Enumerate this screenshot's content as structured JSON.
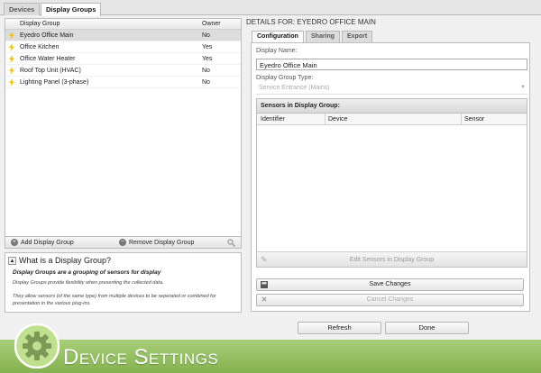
{
  "top_tabs": [
    {
      "label": "Devices",
      "active": false
    },
    {
      "label": "Display Groups",
      "active": true
    }
  ],
  "groups_table": {
    "columns": [
      "Display Group",
      "Owner"
    ],
    "rows": [
      {
        "name": "Eyedro Office Main",
        "owner": "No",
        "selected": true
      },
      {
        "name": "Office Kitchen",
        "owner": "Yes",
        "selected": false
      },
      {
        "name": "Office Water Heater",
        "owner": "Yes",
        "selected": false
      },
      {
        "name": "Roof Top Unit (HVAC)",
        "owner": "No",
        "selected": false
      },
      {
        "name": "Lighting Panel (3-phase)",
        "owner": "No",
        "selected": false
      }
    ]
  },
  "left_toolbar": {
    "add_label": "Add Display Group",
    "remove_label": "Remove Display Group"
  },
  "info": {
    "title": "What is a Display Group?",
    "line1": "Display Groups are a grouping of sensors for display",
    "line2": "Display Groups provide flexibility when presenting the collected data.",
    "line3": "They allow sensors (of the same type) from multiple devices to be seperated or combined for presentation in the various plug-ins."
  },
  "details": {
    "title": "DETAILS FOR: EYEDRO OFFICE MAIN",
    "tabs": [
      {
        "label": "Configuration",
        "active": true
      },
      {
        "label": "Sharing",
        "active": false
      },
      {
        "label": "Export",
        "active": false
      }
    ],
    "display_name_label": "Display Name:",
    "display_name_value": "Eyedro Office Main",
    "group_type_label": "Display Group Type:",
    "group_type_value": "Service Entrance (Mains)",
    "sensors_title": "Sensors in Display Group:",
    "sensor_columns": [
      "Identifier",
      "Device",
      "Sensor"
    ],
    "edit_sensors_label": "Edit Sensors in Display Group",
    "save_label": "Save Changes",
    "cancel_label": "Cancel Changes"
  },
  "footer_buttons": {
    "refresh_label": "Refresh",
    "done_label": "Done"
  },
  "banner": {
    "title": "Device Settings"
  },
  "colors": {
    "banner_green": "#8fba5c",
    "bolt_yellow": "#f2c200",
    "selected_row": "#dcdcdc"
  }
}
